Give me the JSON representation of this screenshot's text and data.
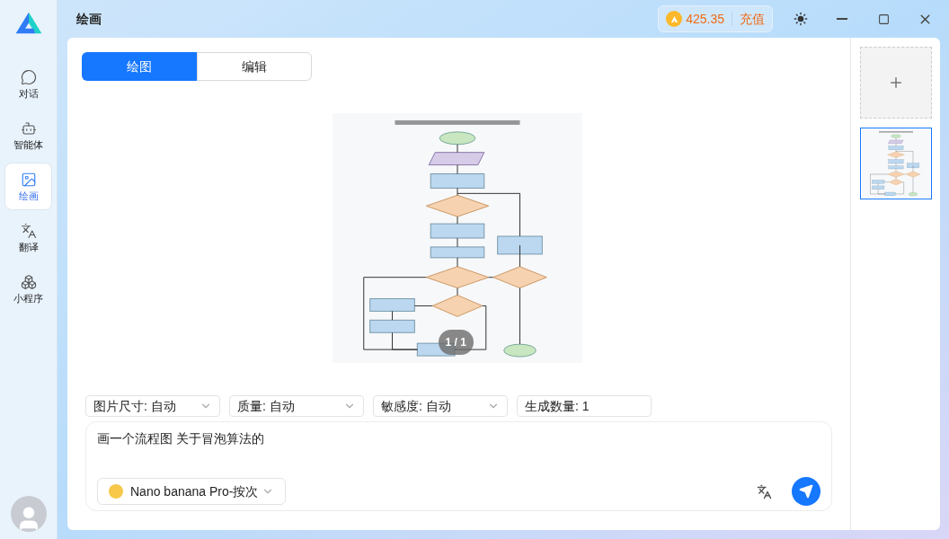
{
  "window": {
    "title": "绘画",
    "balance": "425.35",
    "recharge": "充值"
  },
  "sidebar": {
    "items": [
      {
        "label": "对话",
        "selected": false
      },
      {
        "label": "智能体",
        "selected": false
      },
      {
        "label": "绘画",
        "selected": true
      },
      {
        "label": "翻译",
        "selected": false
      },
      {
        "label": "小程序",
        "selected": false
      }
    ]
  },
  "tabs": [
    {
      "label": "绘图",
      "selected": true
    },
    {
      "label": "编辑",
      "selected": false
    }
  ],
  "preview": {
    "counter": "1 / 1"
  },
  "options": [
    {
      "label": "图片尺寸: 自动",
      "kind": "select"
    },
    {
      "label": "质量: 自动",
      "kind": "select"
    },
    {
      "label": "敏感度: 自动",
      "kind": "select"
    },
    {
      "label": "生成数量: 1",
      "kind": "number"
    }
  ],
  "prompt": {
    "value": "画一个流程图 关于冒泡算法的",
    "model": "Nano banana Pro-按次"
  },
  "gallery": {
    "thumbnails": [
      {
        "selected": true
      }
    ]
  }
}
